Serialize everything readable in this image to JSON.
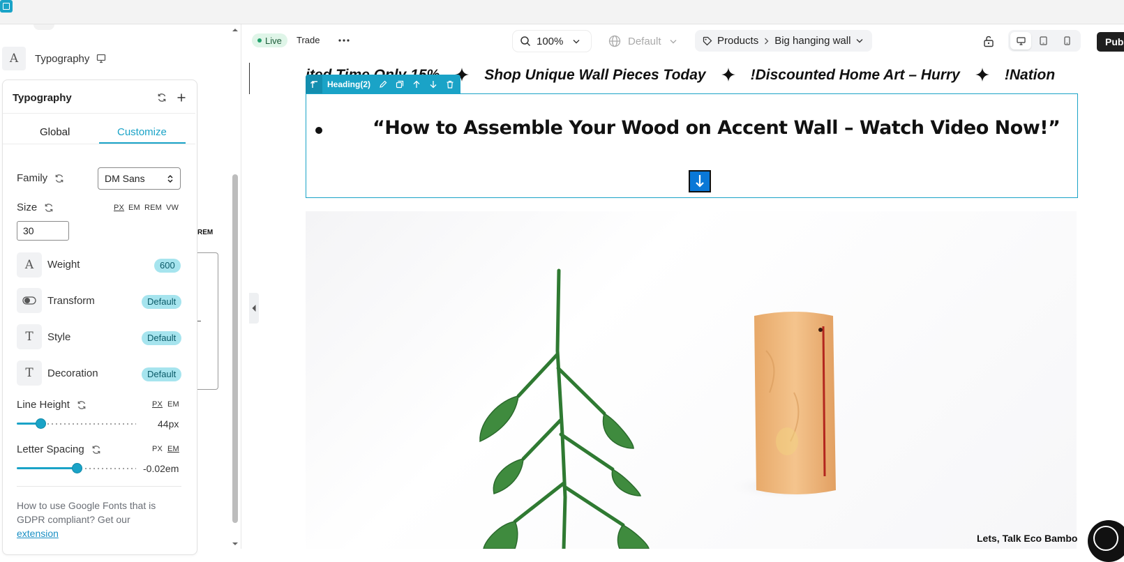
{
  "sidebar": {
    "section_title": "Typography",
    "panel": {
      "title": "Typography",
      "tabs": [
        "Global",
        "Customize"
      ],
      "active_tab": "Customize",
      "family": {
        "label": "Family",
        "value": "DM Sans"
      },
      "size": {
        "label": "Size",
        "units": [
          "PX",
          "EM",
          "REM",
          "VW"
        ],
        "active_unit": "PX",
        "value": "30"
      },
      "weight": {
        "label": "Weight",
        "value": "600"
      },
      "transform": {
        "label": "Transform",
        "value": "Default"
      },
      "style": {
        "label": "Style",
        "value": "Default"
      },
      "decoration": {
        "label": "Decoration",
        "value": "Default"
      },
      "line_height": {
        "label": "Line Height",
        "units": [
          "PX",
          "EM"
        ],
        "active_unit": "PX",
        "value_text": "44px",
        "slider_fraction": 0.2
      },
      "letter_spacing": {
        "label": "Letter Spacing",
        "units": [
          "PX",
          "EM"
        ],
        "active_unit": "EM",
        "value_text": "-0.02em",
        "slider_fraction": 0.5
      },
      "help_text": "How to use Google Fonts that is GDPR compliant? Get our",
      "help_link": "extension"
    },
    "behind_panel_unit": "REM"
  },
  "toolbar": {
    "live_label": "Live",
    "trade_label": "Trade",
    "zoom": "100%",
    "locale": "Default",
    "breadcrumb": [
      "Products",
      "Big hanging wall"
    ],
    "publish_label": "Publ"
  },
  "canvas": {
    "marquee_items": [
      "ited Time Only 15%",
      "Shop Unique Wall Pieces Today",
      "!Discounted Home Art – Hurry",
      "!Nation"
    ],
    "heading_tag": "Heading(2)",
    "heading_text": "“How to Assemble Your Wood on Accent Wall – Watch Video Now!”",
    "footer_text": "Lets, Talk Eco Bambo"
  },
  "colors": {
    "accent": "#1aa3c7",
    "live_dot": "#22a06b",
    "pill_bg": "#a6e4ee",
    "drop_marker": "#0a78d7"
  }
}
